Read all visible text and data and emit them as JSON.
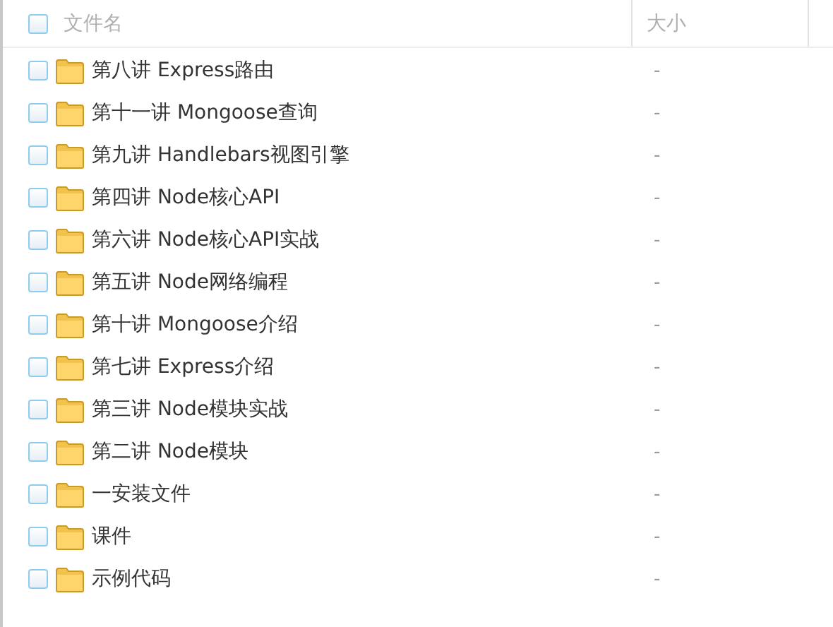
{
  "table": {
    "columns": [
      {
        "label": "文件名",
        "checked": false
      },
      {
        "label": "大小"
      }
    ],
    "rows": [
      {
        "name": "第八讲 Express路由",
        "size": "-",
        "checked": false
      },
      {
        "name": "第十一讲 Mongoose查询",
        "size": "-",
        "checked": false
      },
      {
        "name": "第九讲 Handlebars视图引擎",
        "size": "-",
        "checked": false
      },
      {
        "name": "第四讲 Node核心API",
        "size": "-",
        "checked": false
      },
      {
        "name": "第六讲 Node核心API实战",
        "size": "-",
        "checked": false
      },
      {
        "name": "第五讲 Node网络编程",
        "size": "-",
        "checked": false
      },
      {
        "name": "第十讲 Mongoose介绍",
        "size": "-",
        "checked": false
      },
      {
        "name": "第七讲 Express介绍",
        "size": "-",
        "checked": false
      },
      {
        "name": "第三讲 Node模块实战",
        "size": "-",
        "checked": false
      },
      {
        "name": "第二讲 Node模块",
        "size": "-",
        "checked": false
      },
      {
        "name": "一安装文件",
        "size": "-",
        "checked": false
      },
      {
        "name": "课件",
        "size": "-",
        "checked": false
      },
      {
        "name": "示例代码",
        "size": "-",
        "checked": false
      }
    ]
  }
}
